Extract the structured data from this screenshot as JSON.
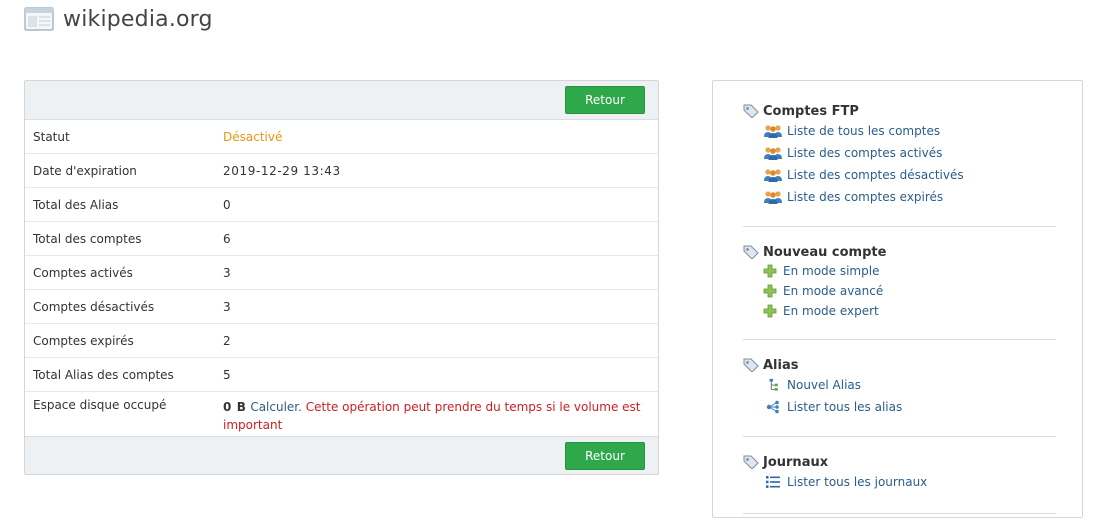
{
  "header": {
    "site": "wikipedia.org",
    "icon": "browser-window-icon"
  },
  "panel": {
    "button_label": "Retour",
    "rows": [
      {
        "label": "Statut",
        "value": "Désactivé"
      },
      {
        "label": "Date d'expiration",
        "value": "2019-12-29 13:43"
      },
      {
        "label": "Total des Alias",
        "value": "0"
      },
      {
        "label": "Total des comptes",
        "value": "6"
      },
      {
        "label": "Comptes activés",
        "value": "3"
      },
      {
        "label": "Comptes désactivés",
        "value": "3"
      },
      {
        "label": "Comptes expirés",
        "value": "2"
      },
      {
        "label": "Total Alias des comptes",
        "value": "5"
      }
    ],
    "disk": {
      "label": "Espace disque occupé",
      "size": "0 B",
      "calc_link": "Calculer.",
      "warning": "Cette opération peut prendre du temps si le volume est important"
    }
  },
  "sidebar": {
    "sections": [
      {
        "title": "Comptes FTP",
        "icon": "tag-icon",
        "items": [
          {
            "label": "Liste de tous les comptes",
            "icon": "users-icon"
          },
          {
            "label": "Liste des comptes activés",
            "icon": "users-icon"
          },
          {
            "label": "Liste des comptes désactivés",
            "icon": "users-icon"
          },
          {
            "label": "Liste des comptes expirés",
            "icon": "users-icon"
          }
        ]
      },
      {
        "title": "Nouveau compte",
        "icon": "tag-icon",
        "items": [
          {
            "label": "En mode simple",
            "icon": "plus-icon"
          },
          {
            "label": "En mode avancé",
            "icon": "plus-icon"
          },
          {
            "label": "En mode expert",
            "icon": "plus-icon"
          }
        ]
      },
      {
        "title": "Alias",
        "icon": "tag-icon",
        "items": [
          {
            "label": "Nouvel Alias",
            "icon": "tree-icon"
          },
          {
            "label": "Lister tous les alias",
            "icon": "share-icon"
          }
        ]
      },
      {
        "title": "Journaux",
        "icon": "tag-icon",
        "items": [
          {
            "label": "Lister tous les journaux",
            "icon": "list-icon"
          }
        ]
      }
    ]
  },
  "colors": {
    "button_green": "#2ea84a",
    "status_orange": "#e8960c",
    "link_blue": "#2b5d8a",
    "warning_red": "#cc1f1f",
    "bar_bg": "#eef1f4"
  }
}
